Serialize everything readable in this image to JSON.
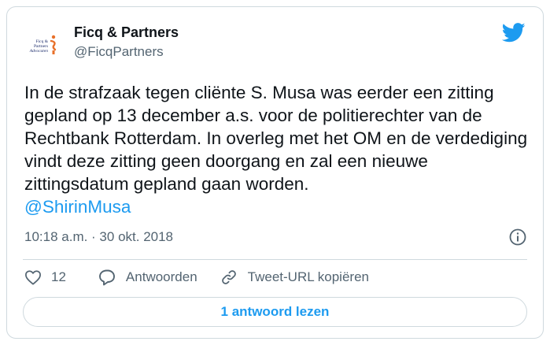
{
  "tweet": {
    "author_name": "Ficq & Partners",
    "author_handle": "@FicqPartners",
    "avatar_logo_line1": "Ficq & Partners",
    "avatar_logo_line2": "Advocaten",
    "text": "In de strafzaak tegen cliënte S. Musa was eerder een zitting gepland op 13 december a.s. voor de politierechter van de Rechtbank Rotterdam. In overleg met het OM en de verdediging vindt deze zitting geen doorgang en zal een nieuwe zittingsdatum gepland gaan worden.",
    "mention": "@ShirinMusa",
    "timestamp": "10:18 a.m. · 30 okt. 2018"
  },
  "actions": {
    "like_count": "12",
    "reply_label": "Antwoorden",
    "copy_link_label": "Tweet-URL kopiëren"
  },
  "read_replies_label": "1 antwoord lezen",
  "icons": {
    "brand": "twitter-bird-icon",
    "info": "info-icon",
    "like": "heart-icon",
    "reply": "speech-bubble-icon",
    "copy": "link-icon"
  },
  "colors": {
    "accent": "#1d9bf0",
    "text": "#0f1419",
    "secondary_text": "#536471",
    "border": "#cfd9de",
    "logo_orange": "#e8702a"
  }
}
